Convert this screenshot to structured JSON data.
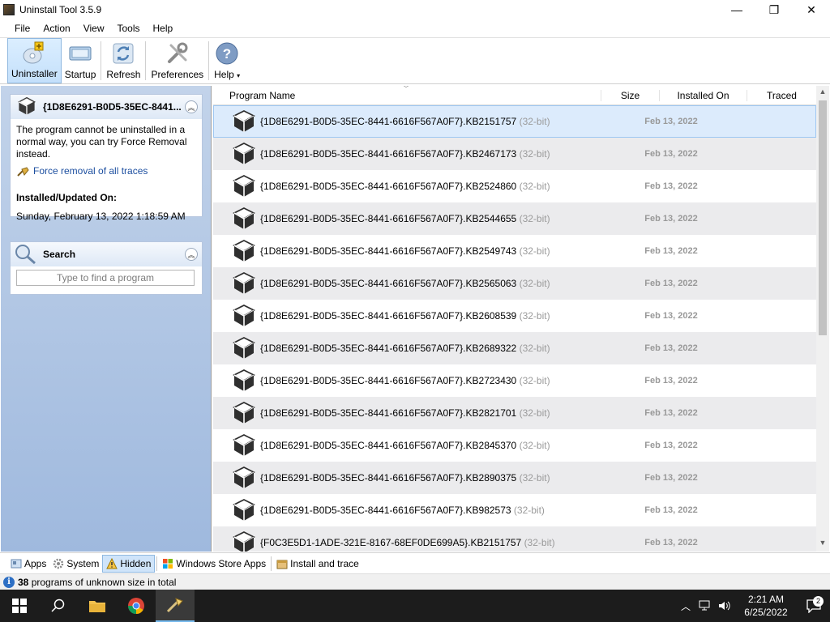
{
  "window": {
    "title": "Uninstall Tool 3.5.9",
    "minimize": "—",
    "maximize": "❐",
    "close": "✕"
  },
  "menu": [
    "File",
    "Action",
    "View",
    "Tools",
    "Help"
  ],
  "toolbar": {
    "buttons": [
      {
        "label": "Uninstaller",
        "icon": "uninstaller-icon"
      },
      {
        "label": "Startup",
        "icon": "startup-icon"
      },
      {
        "label": "Refresh",
        "icon": "refresh-icon"
      },
      {
        "label": "Preferences",
        "icon": "preferences-icon"
      },
      {
        "label": "Help",
        "icon": "help-icon"
      }
    ],
    "help_arrow": "▾"
  },
  "details": {
    "title": "{1D8E6291-B0D5-35EC-8441...",
    "message": "The program cannot be uninstalled in a normal way, you can try Force Removal instead.",
    "force_link": "Force removal of all traces",
    "installed_heading": "Installed/Updated On:",
    "installed_value": "Sunday, February 13, 2022 1:18:59 AM"
  },
  "search": {
    "title": "Search",
    "placeholder": "Type to find a program"
  },
  "columns": {
    "name": "Program Name",
    "size": "Size",
    "installed": "Installed On",
    "traced": "Traced"
  },
  "programs": [
    {
      "name": "{1D8E6291-B0D5-35EC-8441-6616F567A0F7}.KB2151757",
      "bits": "(32-bit)",
      "date": "Feb 13, 2022"
    },
    {
      "name": "{1D8E6291-B0D5-35EC-8441-6616F567A0F7}.KB2467173",
      "bits": "(32-bit)",
      "date": "Feb 13, 2022"
    },
    {
      "name": "{1D8E6291-B0D5-35EC-8441-6616F567A0F7}.KB2524860",
      "bits": "(32-bit)",
      "date": "Feb 13, 2022"
    },
    {
      "name": "{1D8E6291-B0D5-35EC-8441-6616F567A0F7}.KB2544655",
      "bits": "(32-bit)",
      "date": "Feb 13, 2022"
    },
    {
      "name": "{1D8E6291-B0D5-35EC-8441-6616F567A0F7}.KB2549743",
      "bits": "(32-bit)",
      "date": "Feb 13, 2022"
    },
    {
      "name": "{1D8E6291-B0D5-35EC-8441-6616F567A0F7}.KB2565063",
      "bits": "(32-bit)",
      "date": "Feb 13, 2022"
    },
    {
      "name": "{1D8E6291-B0D5-35EC-8441-6616F567A0F7}.KB2608539",
      "bits": "(32-bit)",
      "date": "Feb 13, 2022"
    },
    {
      "name": "{1D8E6291-B0D5-35EC-8441-6616F567A0F7}.KB2689322",
      "bits": "(32-bit)",
      "date": "Feb 13, 2022"
    },
    {
      "name": "{1D8E6291-B0D5-35EC-8441-6616F567A0F7}.KB2723430",
      "bits": "(32-bit)",
      "date": "Feb 13, 2022"
    },
    {
      "name": "{1D8E6291-B0D5-35EC-8441-6616F567A0F7}.KB2821701",
      "bits": "(32-bit)",
      "date": "Feb 13, 2022"
    },
    {
      "name": "{1D8E6291-B0D5-35EC-8441-6616F567A0F7}.KB2845370",
      "bits": "(32-bit)",
      "date": "Feb 13, 2022"
    },
    {
      "name": "{1D8E6291-B0D5-35EC-8441-6616F567A0F7}.KB2890375",
      "bits": "(32-bit)",
      "date": "Feb 13, 2022"
    },
    {
      "name": "{1D8E6291-B0D5-35EC-8441-6616F567A0F7}.KB982573",
      "bits": "(32-bit)",
      "date": "Feb 13, 2022"
    },
    {
      "name": "{F0C3E5D1-1ADE-321E-8167-68EF0DE699A5}.KB2151757",
      "bits": "(32-bit)",
      "date": "Feb 13, 2022"
    }
  ],
  "tabs": [
    {
      "label": "Apps",
      "icon": "apps-icon"
    },
    {
      "label": "System",
      "icon": "system-gear-icon"
    },
    {
      "label": "Hidden",
      "icon": "hidden-warning-icon"
    },
    {
      "label": "Windows Store Apps",
      "icon": "windows-store-icon"
    },
    {
      "label": "Install and trace",
      "icon": "install-trace-icon"
    }
  ],
  "status": {
    "count": "38",
    "text": "programs of unknown size in total"
  },
  "taskbar": {
    "time": "2:21 AM",
    "date": "6/25/2022",
    "notifications": "2"
  },
  "colors": {
    "selection": "#dcebfc",
    "alt_row": "#ebebed",
    "panel": "#b3c8e5",
    "link": "#1d4fa0"
  }
}
